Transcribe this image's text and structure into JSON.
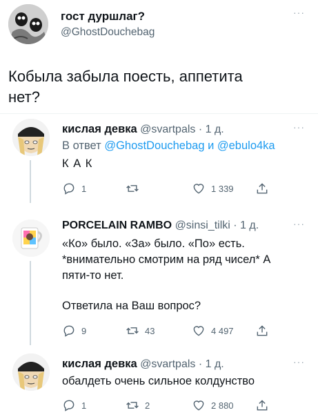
{
  "main": {
    "name": "гост дуршлаг?",
    "handle": "@GhostDouchebag",
    "text_line1": "Кобыла забыла поесть, аппетита",
    "text_line2": "нет?"
  },
  "reply1": {
    "name": "кислая девка",
    "meta": "@svartpals · 1 д.",
    "reply_prefix": "В ответ",
    "reply_to": "@GhostDouchebag и @ebulo4ka",
    "text": "К А К",
    "replies": "1",
    "retweets": "",
    "likes": "1 339"
  },
  "reply2": {
    "name": "PORCELAIN RAMBO",
    "meta": "@sinsi_tilki · 1 д.",
    "line1": "«Ко» было. «За» было. «По» есть.",
    "line2": "*внимательно смотрим на ряд чисел* А",
    "line3": "пяти-то нет.",
    "line4": "Ответила на Ваш вопрос?",
    "replies": "9",
    "retweets": "43",
    "likes": "4 497"
  },
  "reply3": {
    "name": "кислая девка",
    "meta": "@svartpals · 1 д.",
    "text": "обалдеть очень сильное колдунство",
    "replies": "1",
    "retweets": "2",
    "likes": "2 880"
  },
  "icons": {
    "reply": "reply-icon",
    "retweet": "retweet-icon",
    "like": "heart-icon",
    "share": "share-icon",
    "more": "more-icon"
  }
}
